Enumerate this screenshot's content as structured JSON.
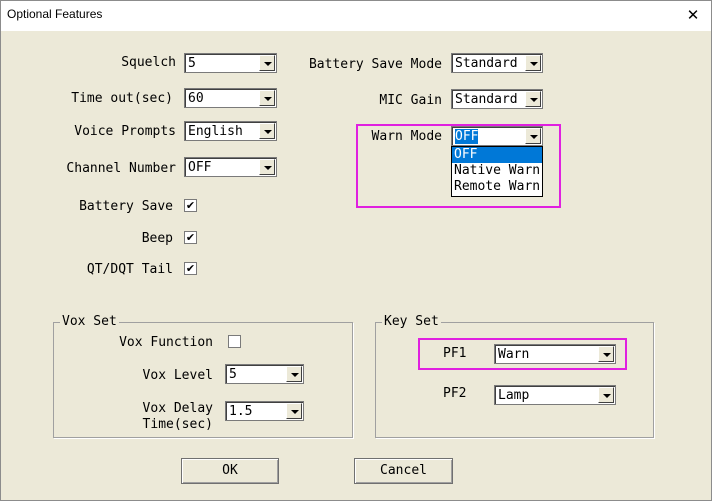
{
  "window": {
    "title": "Optional Features",
    "close": "✕"
  },
  "left": {
    "squelch": {
      "label": "Squelch",
      "value": "5"
    },
    "timeout": {
      "label": "Time out(sec)",
      "value": "60"
    },
    "voice": {
      "label": "Voice Prompts",
      "value": "English"
    },
    "channel": {
      "label": "Channel Number",
      "value": "OFF"
    },
    "battery_save": {
      "label": "Battery Save",
      "checked": "✔"
    },
    "beep": {
      "label": "Beep",
      "checked": "✔"
    },
    "qt_tail": {
      "label": "QT/DQT Tail",
      "checked": "✔"
    }
  },
  "right": {
    "battery_mode": {
      "label": "Battery Save Mode",
      "value": "Standard"
    },
    "mic_gain": {
      "label": "MIC Gain",
      "value": "Standard"
    },
    "warn_mode": {
      "label": "Warn Mode",
      "value": "OFF",
      "options": [
        "OFF",
        "Native Warn",
        "Remote Warn"
      ]
    }
  },
  "vox": {
    "group_label": "Vox Set",
    "function": {
      "label": "Vox Function"
    },
    "level": {
      "label": "Vox Level",
      "value": "5"
    },
    "delay": {
      "label1": "Vox Delay",
      "label2": "Time(sec)",
      "value": "1.5"
    }
  },
  "keyset": {
    "group_label": "Key Set",
    "pf1": {
      "label": "PF1",
      "value": "Warn"
    },
    "pf2": {
      "label": "PF2",
      "value": "Lamp"
    }
  },
  "buttons": {
    "ok": "OK",
    "cancel": "Cancel"
  },
  "colors": {
    "highlight": "#e020e0",
    "selection": "#0078d7",
    "dialog_bg": "#ece9d8"
  }
}
